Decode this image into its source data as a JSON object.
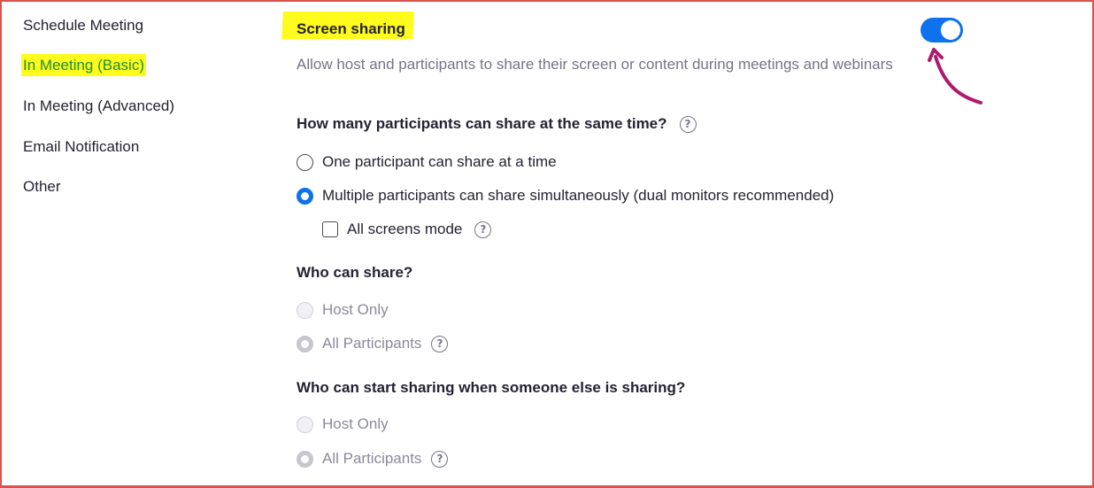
{
  "sidebar": {
    "items": [
      {
        "label": "Schedule Meeting",
        "active": false
      },
      {
        "label": "In Meeting (Basic)",
        "active": true
      },
      {
        "label": "In Meeting (Advanced)",
        "active": false
      },
      {
        "label": "Email Notification",
        "active": false
      },
      {
        "label": "Other",
        "active": false
      }
    ]
  },
  "setting": {
    "title": "Screen sharing",
    "enabled": true,
    "description": "Allow host and participants to share their screen or content during meetings and webinars"
  },
  "share_count": {
    "question": "How many participants can share at the same time?",
    "options": [
      {
        "label": "One participant can share at a time",
        "checked": false
      },
      {
        "label": "Multiple participants can share simultaneously (dual monitors recommended)",
        "checked": true
      }
    ],
    "all_screens": {
      "label": "All screens mode",
      "checked": false
    }
  },
  "who_can_share": {
    "question": "Who can share?",
    "options": [
      {
        "label": "Host Only",
        "checked": false,
        "disabled": true
      },
      {
        "label": "All Participants",
        "checked": true,
        "disabled": true
      }
    ]
  },
  "who_can_start": {
    "question": "Who can start sharing when someone else is sharing?",
    "options": [
      {
        "label": "Host Only",
        "checked": false,
        "disabled": true
      },
      {
        "label": "All Participants",
        "checked": true,
        "disabled": true
      }
    ]
  },
  "help_glyph": "?",
  "colors": {
    "accent": "#0e72ed",
    "highlight": "#fffb1c",
    "active_nav": "#1c8e3a",
    "annotation_arrow": "#b0196b",
    "frame_border": "#d9534f"
  }
}
